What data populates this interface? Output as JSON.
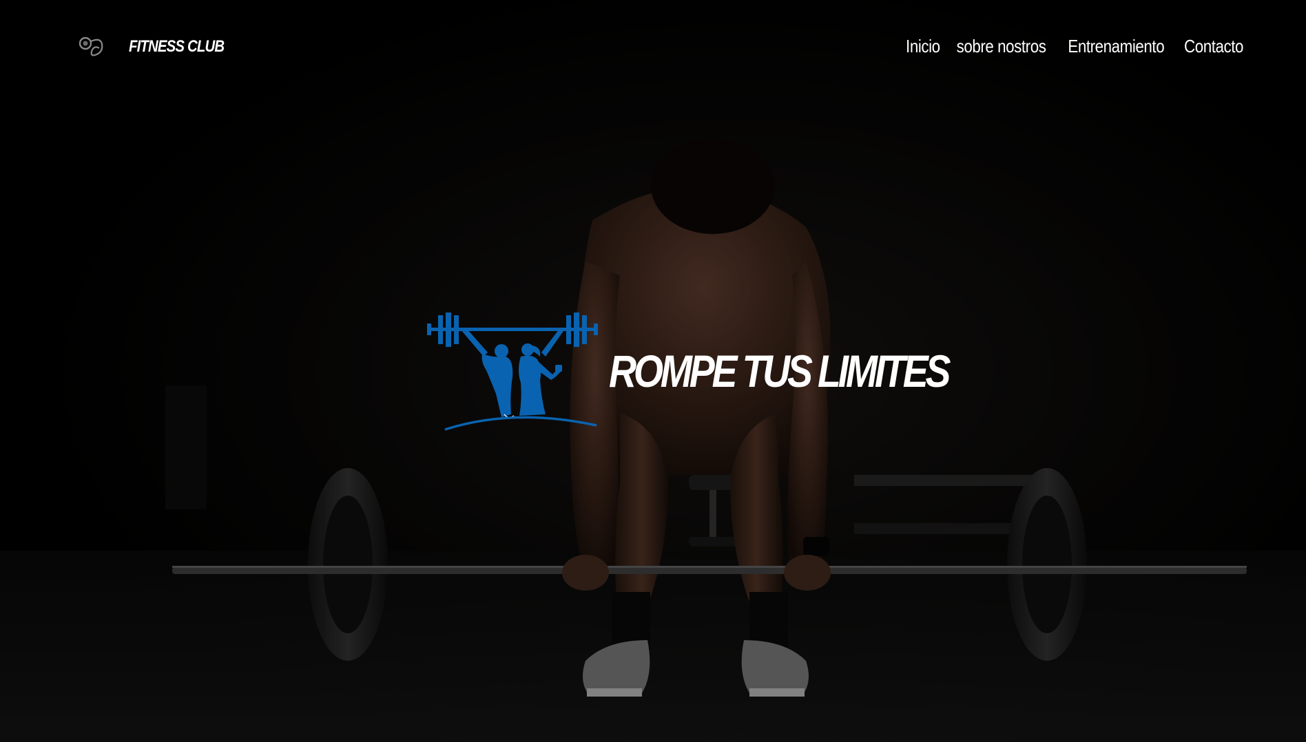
{
  "brand": {
    "name": "FITNESS CLUB",
    "logo_icon": "brand-swirl-icon"
  },
  "nav": {
    "items": [
      {
        "label": "Inicio"
      },
      {
        "label": "sobre nostros"
      },
      {
        "label": "Entrenamiento"
      },
      {
        "label": "Contacto"
      }
    ]
  },
  "hero": {
    "title": "ROMPE TUS LIMITES",
    "logo_icon": "weightlifting-couple-icon",
    "logo_color": "#0a63b0",
    "background": "dark gym photo of athlete gripping a barbell for a deadlift"
  },
  "colors": {
    "background": "#020202",
    "text": "#ffffff",
    "accent": "#0a63b0"
  }
}
